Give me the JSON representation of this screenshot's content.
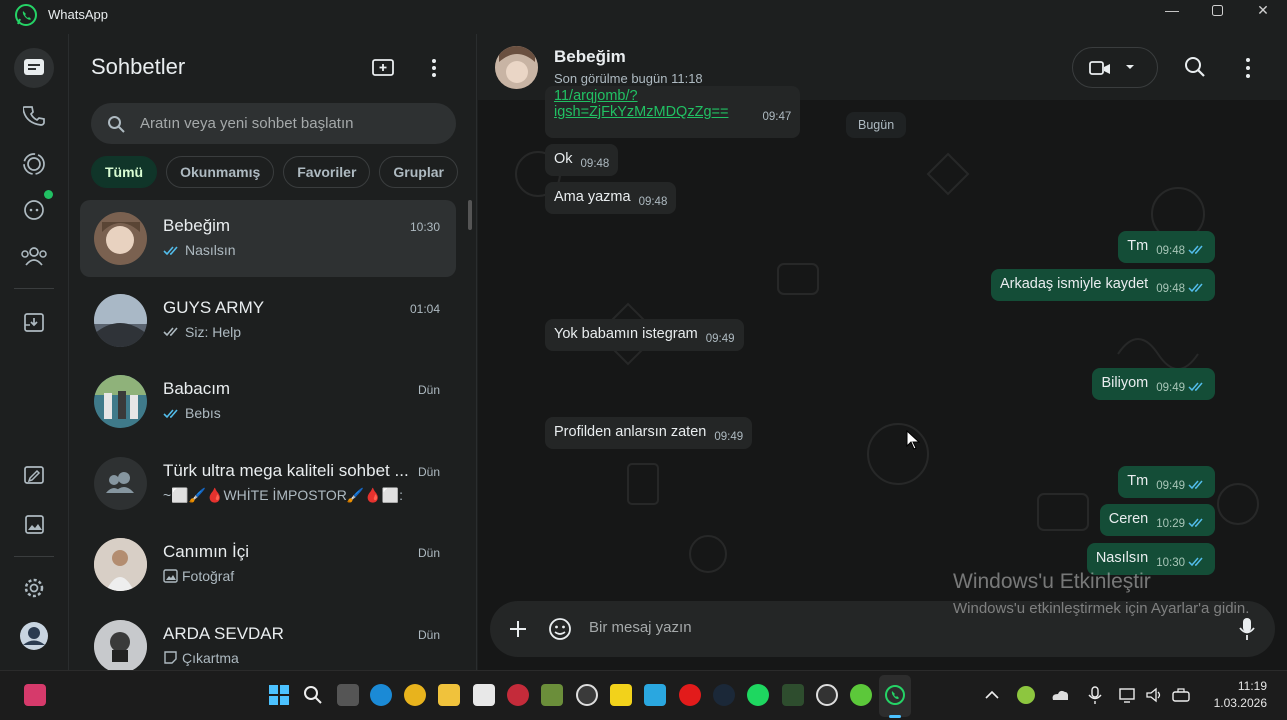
{
  "window": {
    "title": "WhatsApp",
    "controls": [
      "minimize",
      "maximize",
      "close"
    ]
  },
  "rail": {
    "items": [
      {
        "name": "chats-icon",
        "active": true
      },
      {
        "name": "calls-icon"
      },
      {
        "name": "status-icon"
      },
      {
        "name": "channels-icon",
        "badge": true
      },
      {
        "name": "communities-icon"
      },
      {
        "name": "archived-icon"
      },
      {
        "name": "starred-icon"
      },
      {
        "name": "media-icon"
      },
      {
        "name": "settings-icon"
      },
      {
        "name": "profile-avatar"
      }
    ]
  },
  "sidebar": {
    "title": "Sohbetler",
    "search_placeholder": "Aratın veya yeni sohbet başlatın",
    "filters": [
      {
        "label": "Tümü",
        "active": true
      },
      {
        "label": "Okunmamış"
      },
      {
        "label": "Favoriler"
      },
      {
        "label": "Gruplar"
      }
    ],
    "chats": [
      {
        "name": "Bebeğim",
        "time": "10:30",
        "last": "Nasılsın",
        "prefix": "ticks-blue",
        "active": true,
        "avatar_color": "#7a6150"
      },
      {
        "name": "GUYS ARMY",
        "time": "01:04",
        "last": "Siz: Help",
        "prefix": "ticks-gray",
        "avatar_color": "#5b6470"
      },
      {
        "name": "Babacım",
        "time": "Dün",
        "last": "Bebıs",
        "prefix": "ticks-blue",
        "avatar_color": "#3f7a8a"
      },
      {
        "name": "Türk ultra mega kaliteli sohbet ...",
        "time": "Dün",
        "last": "~⬜🖌️🩸WHİTE İMPOSTOR🖌️🩸⬜:",
        "prefix": "",
        "avatar_color": "#3b3f40",
        "group": true
      },
      {
        "name": "Canımın İçi",
        "time": "Dün",
        "last": "Fotoğraf",
        "prefix": "photo",
        "avatar_color": "#b7a79a"
      },
      {
        "name": "ARDA SEVDAR",
        "time": "Dün",
        "last": "Çıkartma",
        "prefix": "sticker",
        "avatar_color": "#6d6e70"
      }
    ]
  },
  "conversation": {
    "name": "Bebeğim",
    "status": "Son görülme bugün 11:18",
    "date_divider": "Bugün",
    "composer_placeholder": "Bir mesaj yazın",
    "messages": [
      {
        "dir": "in",
        "text": "igsh=ZjFkYzMzMDQzZg==",
        "partial": "11/arqjomb/?",
        "time": "09:47",
        "link": true
      },
      {
        "dir": "in",
        "text": "Ok",
        "time": "09:48"
      },
      {
        "dir": "in",
        "text": "Ama yazma",
        "time": "09:48"
      },
      {
        "dir": "out",
        "text": "Tm",
        "time": "09:48"
      },
      {
        "dir": "out",
        "text": "Arkadaş ismiyle kaydet",
        "time": "09:48"
      },
      {
        "dir": "in",
        "text": "Yok babamın istegram",
        "time": "09:49"
      },
      {
        "dir": "out",
        "text": "Biliyom",
        "time": "09:49"
      },
      {
        "dir": "in",
        "text": "Profilden anlarsın zaten",
        "time": "09:49"
      },
      {
        "dir": "out",
        "text": "Tm",
        "time": "09:49"
      },
      {
        "dir": "out",
        "text": "Ceren",
        "time": "10:29"
      },
      {
        "dir": "out",
        "text": "Nasılsın",
        "time": "10:30"
      }
    ]
  },
  "watermark": {
    "line1": "Windows'u Etkinleştir",
    "line2": "Windows'u etkinleştirmek için Ayarlar'a gidin."
  },
  "taskbar": {
    "time": "11:19",
    "date": "1.03.2026"
  },
  "colors": {
    "accent": "#21c063",
    "outgoing": "#144d37",
    "incoming": "#242626",
    "blue_ticks": "#53bdeb"
  }
}
